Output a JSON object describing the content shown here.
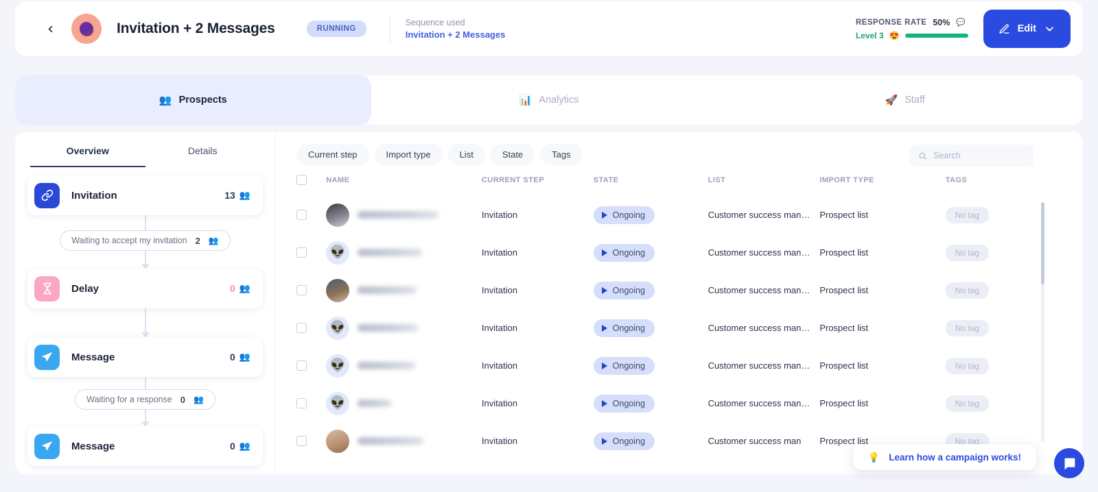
{
  "header": {
    "back_icon": "chevron-left-icon",
    "avatar_icon": "campaign-avatar",
    "title": "Invitation + 2 Messages",
    "status": "RUNNING",
    "sequence_label": "Sequence used",
    "sequence_value": "Invitation + 2 Messages",
    "response_rate_label": "RESPONSE RATE",
    "response_rate_value": "50%",
    "response_rate_info_icon": "comment-icon",
    "level_label": "Level 3",
    "level_emoji": "😍",
    "progress_percent": 100,
    "edit_label": "Edit",
    "edit_icon": "pencil-icon",
    "edit_chevron_icon": "chevron-down-icon",
    "accent_color": "#2a4ae0",
    "progress_color": "#16b37f"
  },
  "tabs": [
    {
      "label": "Prospects",
      "icon": "people-icon",
      "active": true
    },
    {
      "label": "Analytics",
      "icon": "analytics-icon",
      "active": false
    },
    {
      "label": "Staff",
      "icon": "rocket-icon",
      "active": false
    }
  ],
  "left_pane": {
    "subtabs": [
      {
        "label": "Overview",
        "active": true
      },
      {
        "label": "Details",
        "active": false
      }
    ],
    "steps": [
      {
        "kind": "step",
        "name": "Invitation",
        "icon": "link-icon",
        "count": "13",
        "people_icon": "people-icon",
        "color": "#2b49d6",
        "count_color": "blue"
      },
      {
        "kind": "wait",
        "label": "Waiting to accept my invitation",
        "count": "2",
        "people_icon": "people-icon"
      },
      {
        "kind": "step",
        "name": "Delay",
        "icon": "hourglass-icon",
        "count": "0",
        "people_icon": "people-icon",
        "color": "#fba7c4",
        "count_color": "pink"
      },
      {
        "kind": "step",
        "name": "Message",
        "icon": "send-icon",
        "count": "0",
        "people_icon": "people-icon",
        "color": "#3aa8f0",
        "count_color": "blue"
      },
      {
        "kind": "wait",
        "label": "Waiting for a response",
        "count": "0",
        "people_icon": "people-icon"
      },
      {
        "kind": "step",
        "name": "Message",
        "icon": "send-icon",
        "count": "0",
        "people_icon": "people-icon",
        "color": "#3aa8f0",
        "count_color": "blue"
      }
    ]
  },
  "filters": [
    {
      "label": "Current step"
    },
    {
      "label": "Import type"
    },
    {
      "label": "List"
    },
    {
      "label": "State"
    },
    {
      "label": "Tags"
    }
  ],
  "search": {
    "placeholder": "Search",
    "value": "",
    "icon": "search-icon"
  },
  "table": {
    "columns": [
      "NAME",
      "CURRENT STEP",
      "STATE",
      "LIST",
      "IMPORT TYPE",
      "TAGS"
    ],
    "select_all_icon": "checkbox-icon",
    "rows": [
      {
        "name": "",
        "avatar": "photo1",
        "current_step": "Invitation",
        "state": "Ongoing",
        "list": "Customer success man…",
        "import_type": "Prospect list",
        "tag": "No tag"
      },
      {
        "name": "",
        "avatar": "alien",
        "current_step": "Invitation",
        "state": "Ongoing",
        "list": "Customer success man…",
        "import_type": "Prospect list",
        "tag": "No tag"
      },
      {
        "name": "",
        "avatar": "photo2",
        "current_step": "Invitation",
        "state": "Ongoing",
        "list": "Customer success man…",
        "import_type": "Prospect list",
        "tag": "No tag"
      },
      {
        "name": "",
        "avatar": "alien",
        "current_step": "Invitation",
        "state": "Ongoing",
        "list": "Customer success man…",
        "import_type": "Prospect list",
        "tag": "No tag"
      },
      {
        "name": "",
        "avatar": "alien",
        "current_step": "Invitation",
        "state": "Ongoing",
        "list": "Customer success man…",
        "import_type": "Prospect list",
        "tag": "No tag"
      },
      {
        "name": "",
        "avatar": "alien",
        "current_step": "Invitation",
        "state": "Ongoing",
        "list": "Customer success man…",
        "import_type": "Prospect list",
        "tag": "No tag"
      },
      {
        "name": "",
        "avatar": "photo3",
        "current_step": "Invitation",
        "state": "Ongoing",
        "list": "Customer success man",
        "import_type": "Prospect list",
        "tag": "No tag"
      }
    ]
  },
  "footer": {
    "learn_label": "Learn how a campaign works!",
    "learn_icon": "lightbulb-icon",
    "chat_icon": "chat-bubble-icon"
  }
}
